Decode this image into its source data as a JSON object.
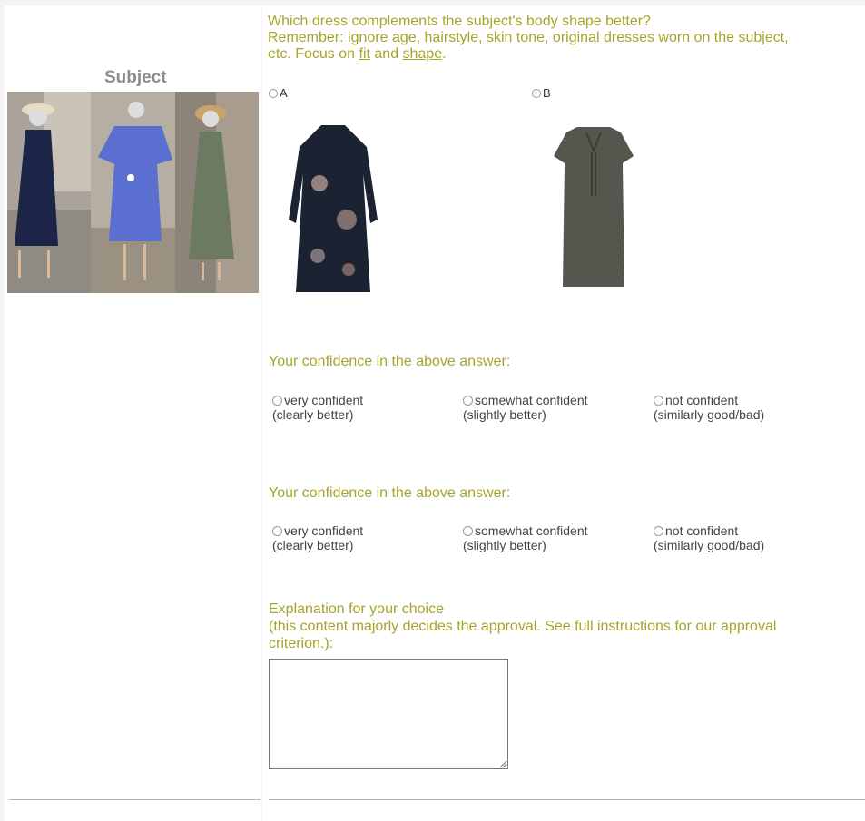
{
  "question": {
    "line1": "Which dress complements the subject's body shape better?",
    "line2": "Remember: ignore age, hairstyle, skin tone, original dresses worn on the subject,",
    "line3_prefix": "etc. Focus on ",
    "fit": "fit",
    "and": " and ",
    "shape": "shape",
    "period": "."
  },
  "subject": {
    "label": "Subject",
    "photo_dress_colors": [
      "#1c2547",
      "#5a6fd0",
      "#6d7a62"
    ]
  },
  "options": [
    {
      "label": "A",
      "dress_color": "#1b2333"
    },
    {
      "label": "B",
      "dress_color": "#55574e"
    }
  ],
  "confidence_blocks": [
    {
      "title": "Your confidence in the above answer:",
      "options": [
        {
          "label": "very confident",
          "sub": "(clearly better)"
        },
        {
          "label": "somewhat confident",
          "sub": "(slightly better)"
        },
        {
          "label": "not confident",
          "sub": "(similarly good/bad)"
        }
      ]
    },
    {
      "title": "Your confidence in the above answer:",
      "options": [
        {
          "label": "very confident",
          "sub": "(clearly better)"
        },
        {
          "label": "somewhat confident",
          "sub": "(slightly better)"
        },
        {
          "label": "not confident",
          "sub": "(similarly good/bad)"
        }
      ]
    }
  ],
  "explanation": {
    "line1": "Explanation for your choice",
    "line2": "(this content majorly decides the approval. See full instructions for our approval",
    "line3": "criterion.):",
    "value": ""
  },
  "colors": {
    "accent": "#a6a52a",
    "subject_label": "#8c8c8c"
  }
}
